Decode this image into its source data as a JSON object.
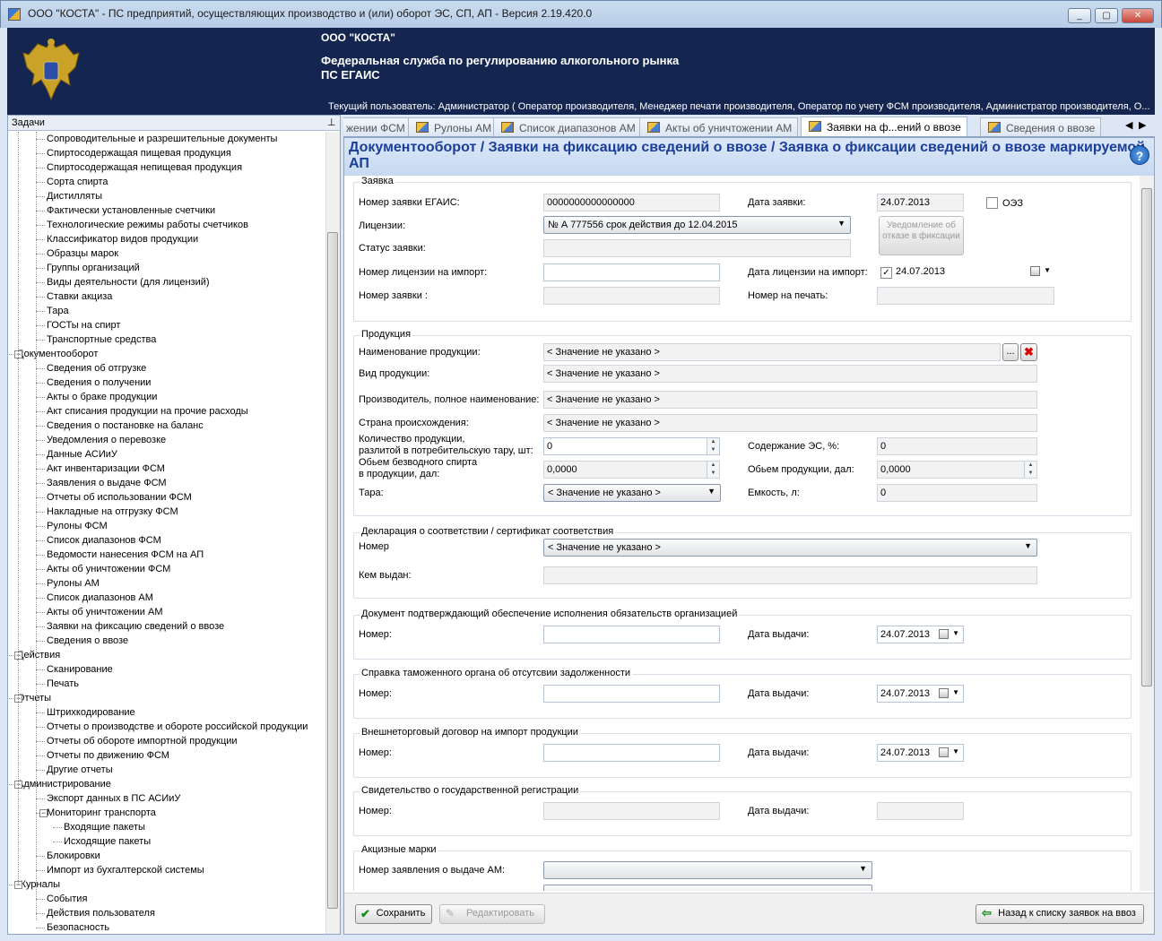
{
  "window": {
    "title": "ООО \"КОСТА\" - ПС предприятий, осуществляющих производство и (или) оборот ЭС, СП, АП - Версия 2.19.420.0",
    "min": "_",
    "max": "▢",
    "close": "✕"
  },
  "header": {
    "company": "ООО \"КОСТА\"",
    "org_line1": "Федеральная служба по регулированию алкогольного рынка",
    "org_line2": "ПС ЕГАИС",
    "user": "Текущий пользователь: Администратор ( Оператор производителя, Менеджер печати производителя, Оператор по учету ФСМ производителя, Администратор производителя, О..."
  },
  "left_panel": {
    "title": "Задачи",
    "pin": "📌"
  },
  "tree": [
    {
      "t": "Сопроводительные и разрешительные документы",
      "l": 2
    },
    {
      "t": "Спиртосодержащая пищевая продукция",
      "l": 2
    },
    {
      "t": "Спиртосодержащая непищевая продукция",
      "l": 2
    },
    {
      "t": "Сорта спирта",
      "l": 2
    },
    {
      "t": "Дистилляты",
      "l": 2
    },
    {
      "t": "Фактически установленные счетчики",
      "l": 2
    },
    {
      "t": "Технологические режимы работы счетчиков",
      "l": 2
    },
    {
      "t": "Классификатор видов продукции",
      "l": 2
    },
    {
      "t": "Образцы марок",
      "l": 2
    },
    {
      "t": "Группы организаций",
      "l": 2
    },
    {
      "t": "Виды деятельности (для лицензий)",
      "l": 2
    },
    {
      "t": "Ставки акциза",
      "l": 2
    },
    {
      "t": "Тара",
      "l": 2
    },
    {
      "t": "ГОСТы на спирт",
      "l": 2
    },
    {
      "t": "Транспортные средства",
      "l": 2
    },
    {
      "t": "Документооборот",
      "l": 1,
      "g": "−"
    },
    {
      "t": "Сведения об отгрузке",
      "l": 2
    },
    {
      "t": "Сведения о получении",
      "l": 2
    },
    {
      "t": "Акты о браке продукции",
      "l": 2
    },
    {
      "t": "Акт списания продукции на прочие расходы",
      "l": 2
    },
    {
      "t": "Сведения о постановке на баланс",
      "l": 2
    },
    {
      "t": "Уведомления о перевозке",
      "l": 2
    },
    {
      "t": "Данные АСИиУ",
      "l": 2
    },
    {
      "t": "Акт инвентаризации ФСМ",
      "l": 2
    },
    {
      "t": "Заявления о выдаче ФСМ",
      "l": 2
    },
    {
      "t": "Отчеты об использовании ФСМ",
      "l": 2
    },
    {
      "t": "Накладные на отгрузку ФСМ",
      "l": 2
    },
    {
      "t": "Рулоны ФСМ",
      "l": 2
    },
    {
      "t": "Список диапазонов ФСМ",
      "l": 2
    },
    {
      "t": "Ведомости нанесения ФСМ на АП",
      "l": 2
    },
    {
      "t": "Акты об уничтожении ФСМ",
      "l": 2
    },
    {
      "t": "Рулоны АМ",
      "l": 2
    },
    {
      "t": "Список диапазонов АМ",
      "l": 2
    },
    {
      "t": "Акты об уничтожении АМ",
      "l": 2
    },
    {
      "t": "Заявки на фиксацию сведений о ввозе",
      "l": 2
    },
    {
      "t": "Сведения о ввозе",
      "l": 2
    },
    {
      "t": "Действия",
      "l": 1,
      "g": "−"
    },
    {
      "t": "Сканирование",
      "l": 2
    },
    {
      "t": "Печать",
      "l": 2
    },
    {
      "t": "Отчеты",
      "l": 1,
      "g": "−"
    },
    {
      "t": "Штрихкодирование",
      "l": 2
    },
    {
      "t": "Отчеты о производстве и обороте российской продукции",
      "l": 2
    },
    {
      "t": "Отчеты об обороте импортной продукции",
      "l": 2
    },
    {
      "t": "Отчеты по движению ФСМ",
      "l": 2
    },
    {
      "t": "Другие отчеты",
      "l": 2
    },
    {
      "t": "Администрирование",
      "l": 1,
      "g": "−"
    },
    {
      "t": "Экспорт данных в ПС АСИиУ",
      "l": 2
    },
    {
      "t": "Мониторинг транспорта",
      "l": 2,
      "g": "−"
    },
    {
      "t": "Входящие пакеты",
      "l": 3
    },
    {
      "t": "Исходящие пакеты",
      "l": 3
    },
    {
      "t": "Блокировки",
      "l": 2
    },
    {
      "t": "Импорт из бухгалтерской системы",
      "l": 2
    },
    {
      "t": "Журналы",
      "l": 1,
      "g": "−"
    },
    {
      "t": "События",
      "l": 2
    },
    {
      "t": "Действия пользователя",
      "l": 2
    },
    {
      "t": "Безопасность",
      "l": 2
    }
  ],
  "tabs": [
    {
      "label": "жении ФСМ",
      "icon": false
    },
    {
      "label": "Рулоны АМ",
      "icon": true
    },
    {
      "label": "Список диапазонов АМ",
      "icon": true
    },
    {
      "label": "Акты об уничтожении АМ",
      "icon": true
    },
    {
      "label": "Заявки на ф...ений о ввозе",
      "icon": true,
      "active": true
    },
    {
      "label": "Сведения о ввозе",
      "icon": true
    }
  ],
  "tab_nav": {
    "prev": "◀",
    "next": "▶"
  },
  "content": {
    "title": "Документооборот / Заявки на фиксацию сведений о ввозе / Заявка о фиксации сведений о ввозе маркируемой АП",
    "help": "?"
  },
  "form": {
    "zayavka": {
      "group": "Заявка",
      "egais_label": "Номер заявки ЕГАИС:",
      "egais_value": "0000000000000000",
      "date_label": "Дата заявки:",
      "date_value": "24.07.2013",
      "oez_label": "ОЭЗ",
      "licenses_label": "Лицензии:",
      "licenses_value": "№ А 777556 срок действия до 12.04.2015",
      "refusal_button": "Уведомление об отказе в фиксации",
      "status_label": "Статус заявки:",
      "status_value": "",
      "import_license_label": "Номер лицензии на импорт:",
      "import_license_value": "",
      "import_license_date_label": "Дата лицензии на импорт:",
      "import_license_date_value": "24.07.2013",
      "request_no_label": "Номер заявки :",
      "request_no_value": "",
      "print_no_label": "Номер на печать:",
      "print_no_value": ""
    },
    "product": {
      "group": "Продукция",
      "name_label": "Наименование продукции:",
      "name_value": "< Значение не указано >",
      "browse": "...",
      "type_label": "Вид продукции:",
      "type_value": "< Значение не указано >",
      "maker_label": "Производитель, полное наименование:",
      "maker_value": "< Значение не указано >",
      "country_label": "Страна происхождения:",
      "country_value": "< Значение не указано >",
      "qty_label1": "Количество продукции,",
      "qty_label2": "разлитой в потребительскую тару, шт:",
      "qty_value": "0",
      "es_label": "Содержание ЭС, %:",
      "es_value": "0",
      "vol_label1": "Обьем безводного спирта",
      "vol_label2": "в продукции, дал:",
      "vol_value": "0,0000",
      "prodvol_label": "Обьем продукции, дал:",
      "prodvol_value": "0,0000",
      "tara_label": "Тара:",
      "tara_value": "< Значение не указано >",
      "capacity_label": "Емкость, л:",
      "capacity_value": "0"
    },
    "declaration": {
      "group": "Декларация о соответствии / сертификат соответствия",
      "number_label": "Номер",
      "number_value": "< Значение не указано >",
      "issuer_label": "Кем выдан:",
      "issuer_value": ""
    },
    "guarantee": {
      "group": "Документ подтверждающий обеспечение исполнения обязательств организацией",
      "number_label": "Номер:",
      "number_value": "",
      "date_label": "Дата выдачи:",
      "date_value": "24.07.2013"
    },
    "customs": {
      "group": "Справка таможенного органа об отсутсвии задолженности",
      "number_label": "Номер:",
      "number_value": "",
      "date_label": "Дата выдачи:",
      "date_value": "24.07.2013"
    },
    "contract": {
      "group": "Внешнеторговый договор на импорт продукции",
      "number_label": "Номер:",
      "number_value": "",
      "date_label": "Дата выдачи:",
      "date_value": "24.07.2013"
    },
    "registration": {
      "group": "Свидетельство о государственной регистрации",
      "number_label": "Номер:",
      "number_value": "",
      "date_label": "Дата выдачи:",
      "date_value": ""
    },
    "excise": {
      "group": "Акцизные марки",
      "request_label": "Номер заявления о выдаче АМ:",
      "request_value": ""
    }
  },
  "buttons": {
    "save": "Сохранить",
    "edit": "Редактировать",
    "back": "Назад к списку заявок на ввоз"
  }
}
